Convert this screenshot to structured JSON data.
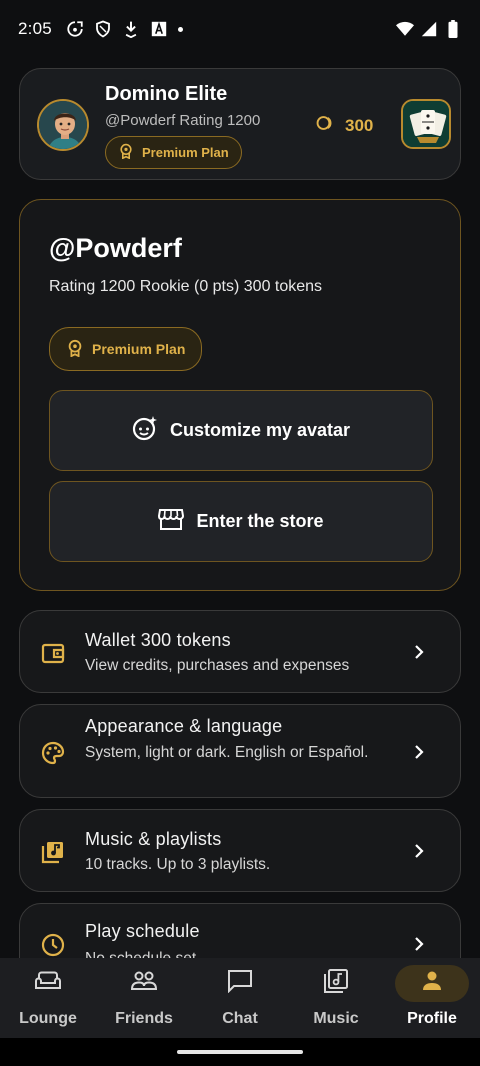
{
  "status_bar": {
    "time": "2:05",
    "icons_left": [
      "sync-icon",
      "shield-icon",
      "download-icon",
      "text-a-icon",
      "notification-dot"
    ],
    "icons_right": [
      "wifi-icon",
      "cellular-icon",
      "battery-icon"
    ]
  },
  "header": {
    "title": "Domino Elite",
    "subtitle": "@Powderf  Rating 1200",
    "badge_label": "Premium Plan",
    "tokens_count": "300",
    "avatar_icon": "user-avatar",
    "app_icon": "domino-cards-icon"
  },
  "profile_card": {
    "handle": "@Powderf",
    "stats": "Rating 1200  Rookie (0 pts)  300 tokens",
    "badge_label": "Premium Plan",
    "customize_button_label": "Customize my avatar",
    "store_button_label": "Enter the store"
  },
  "settings": [
    {
      "icon": "wallet-icon",
      "title": "Wallet  300 tokens",
      "subtitle": "View credits, purchases and expenses"
    },
    {
      "icon": "palette-icon",
      "title": "Appearance & language",
      "subtitle": "System, light or dark. English or Español."
    },
    {
      "icon": "music-note-icon",
      "title": "Music & playlists",
      "subtitle": "10 tracks. Up to 3 playlists."
    },
    {
      "icon": "clock-icon",
      "title": "Play schedule",
      "subtitle": "No schedule set"
    }
  ],
  "bottom_nav": [
    {
      "label": "Lounge",
      "icon": "sofa-icon",
      "active": false
    },
    {
      "label": "Friends",
      "icon": "people-icon",
      "active": false
    },
    {
      "label": "Chat",
      "icon": "chat-icon",
      "active": false
    },
    {
      "label": "Music",
      "icon": "music-library-icon",
      "active": false
    },
    {
      "label": "Profile",
      "icon": "person-icon",
      "active": true
    }
  ],
  "colors": {
    "accent_gold": "#e0b24a",
    "background": "#0e0f11",
    "card": "#1a1c1f",
    "active_nav": "#3d331b"
  }
}
